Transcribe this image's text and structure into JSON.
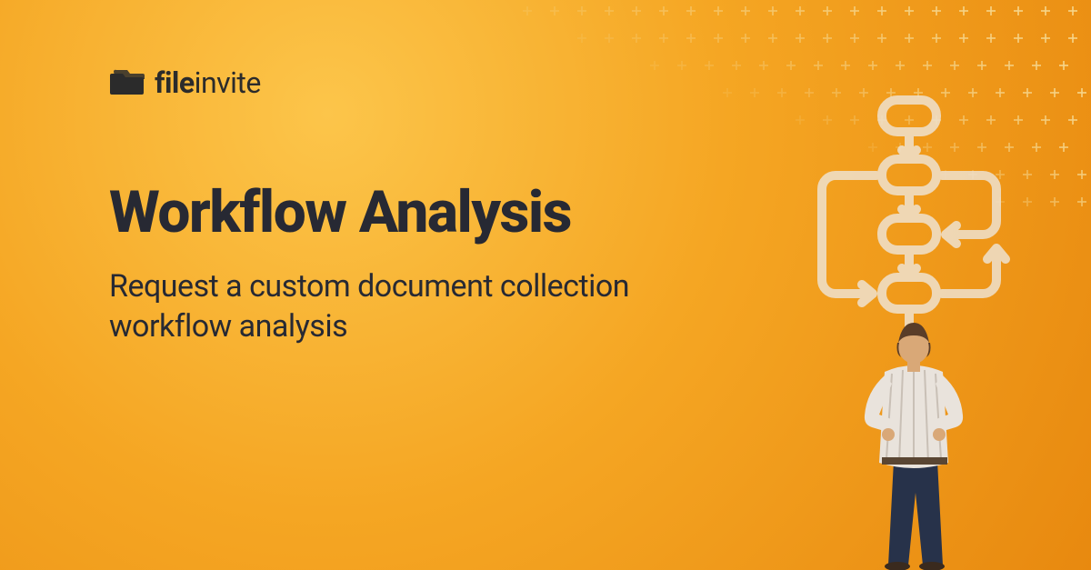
{
  "brand": {
    "name_prefix": "file",
    "name_suffix": "invite"
  },
  "hero": {
    "title": "Workflow Analysis",
    "subtitle": "Request a custom document collection workflow analysis"
  },
  "colors": {
    "bg_start": "#fcc54a",
    "bg_mid": "#f5a623",
    "bg_end": "#e8890f",
    "text_dark": "#272933",
    "flowchart_stroke": "#efe2cf"
  }
}
